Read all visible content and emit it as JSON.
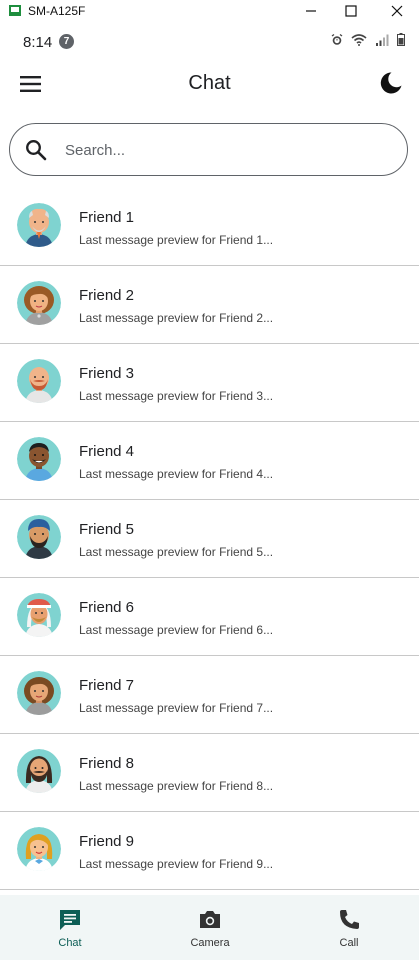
{
  "window": {
    "title": "SM-A125F"
  },
  "statusbar": {
    "time": "8:14",
    "notification_count": "7"
  },
  "appbar": {
    "title": "Chat"
  },
  "search": {
    "placeholder": "Search..."
  },
  "chats": [
    {
      "name": "Friend 1",
      "preview": "Last message preview for Friend 1...",
      "avatar": "avatar-old-man-bald"
    },
    {
      "name": "Friend 2",
      "preview": "Last message preview for Friend 2...",
      "avatar": "avatar-woman-curly"
    },
    {
      "name": "Friend 3",
      "preview": "Last message preview for Friend 3...",
      "avatar": "avatar-man-bald-beard"
    },
    {
      "name": "Friend 4",
      "preview": "Last message preview for Friend 4...",
      "avatar": "avatar-man-smiling"
    },
    {
      "name": "Friend 5",
      "preview": "Last message preview for Friend 5...",
      "avatar": "avatar-man-turban"
    },
    {
      "name": "Friend 6",
      "preview": "Last message preview for Friend 6...",
      "avatar": "avatar-man-keffiyeh"
    },
    {
      "name": "Friend 7",
      "preview": "Last message preview for Friend 7...",
      "avatar": "avatar-woman-curly-2"
    },
    {
      "name": "Friend 8",
      "preview": "Last message preview for Friend 8...",
      "avatar": "avatar-man-long-hair"
    },
    {
      "name": "Friend 9",
      "preview": "Last message preview for Friend 9...",
      "avatar": "avatar-woman-blonde"
    }
  ],
  "bottomnav": {
    "chat_label": "Chat",
    "camera_label": "Camera",
    "call_label": "Call"
  },
  "colors": {
    "accent": "#0d5e56",
    "nav_bg": "#f1f6f6",
    "avatar_bg": "#7fd3d0"
  }
}
